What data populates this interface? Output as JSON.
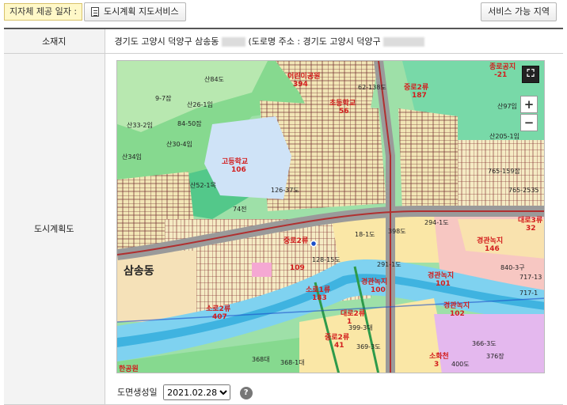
{
  "toolbar": {
    "provide_date_label": "지자체 제공 일자 :",
    "map_service_label": "도시계획 지도서비스",
    "available_area_label": "서비스 가능 지역",
    "map_icon": "document-icon"
  },
  "info": {
    "location_header": "소재지",
    "location_prefix": "경기도 고양시 덕양구 삼송동",
    "road_address_prefix": "(도로명 주소 : 경기도 고양시 덕양구",
    "plan_header": "도시계획도"
  },
  "map": {
    "controls": {
      "fullscreen_icon": "fullscreen-icon",
      "zoom_in": "+",
      "zoom_out": "−"
    },
    "labels": {
      "park1": "어린이공원",
      "park1_num": "394",
      "school1": "초등학교",
      "school1_num": "56",
      "highschool": "고등학교",
      "highschool_num": "106",
      "road_a": "중로2류",
      "road_a_num": "187",
      "road_b": "중로2류",
      "road_b_num": "109",
      "road_c": "소로1류",
      "road_c_num": "183",
      "road_d": "대로2류",
      "road_d_num": "1",
      "road_e": "대로3류",
      "road_e_num": "32",
      "road_f": "중로2류",
      "road_f_num": "41",
      "road_g": "소로2류",
      "road_g_num": "407",
      "green1": "경관녹지",
      "green1_num": "100",
      "green2": "경관녹지",
      "green2_num": "101",
      "green3": "경관녹지",
      "green3_num": "102",
      "green4": "경관녹지",
      "green4_num": "146",
      "district": "삼송동",
      "small_1": "산84도",
      "small_2": "9-7잡",
      "small_3": "산26-1임",
      "small_4": "84-50잡",
      "small_5": "산33-2임",
      "small_6": "산30-4임",
      "small_7": "산34임",
      "small_8": "산52-1목",
      "small_9": "74전",
      "small_10": "294-1도",
      "small_11": "398도",
      "small_12": "291-1도",
      "small_13": "399-3대",
      "small_14": "369-3도",
      "small_15": "368대",
      "small_16": "368-1대",
      "small_17": "376장",
      "small_18": "400도",
      "small_19": "717-13",
      "small_20": "765-159잡",
      "small_21": "산97임",
      "small_22": "산205-1임",
      "small_23": "62-138도",
      "small_24": "128-15도",
      "small_25": "18-1도",
      "small_26": "840-3구",
      "small_27": "717-1",
      "small_28": "765-2535",
      "small_29": "126-37도",
      "small_30": "366-3도",
      "small_31": "소화천",
      "small_32": "3",
      "small_33": "종로공지",
      "small_34": "-21",
      "small_35": "한공원"
    }
  },
  "date": {
    "label": "도면생성일",
    "selected": "2021.02.28",
    "help_icon": "help-icon"
  }
}
